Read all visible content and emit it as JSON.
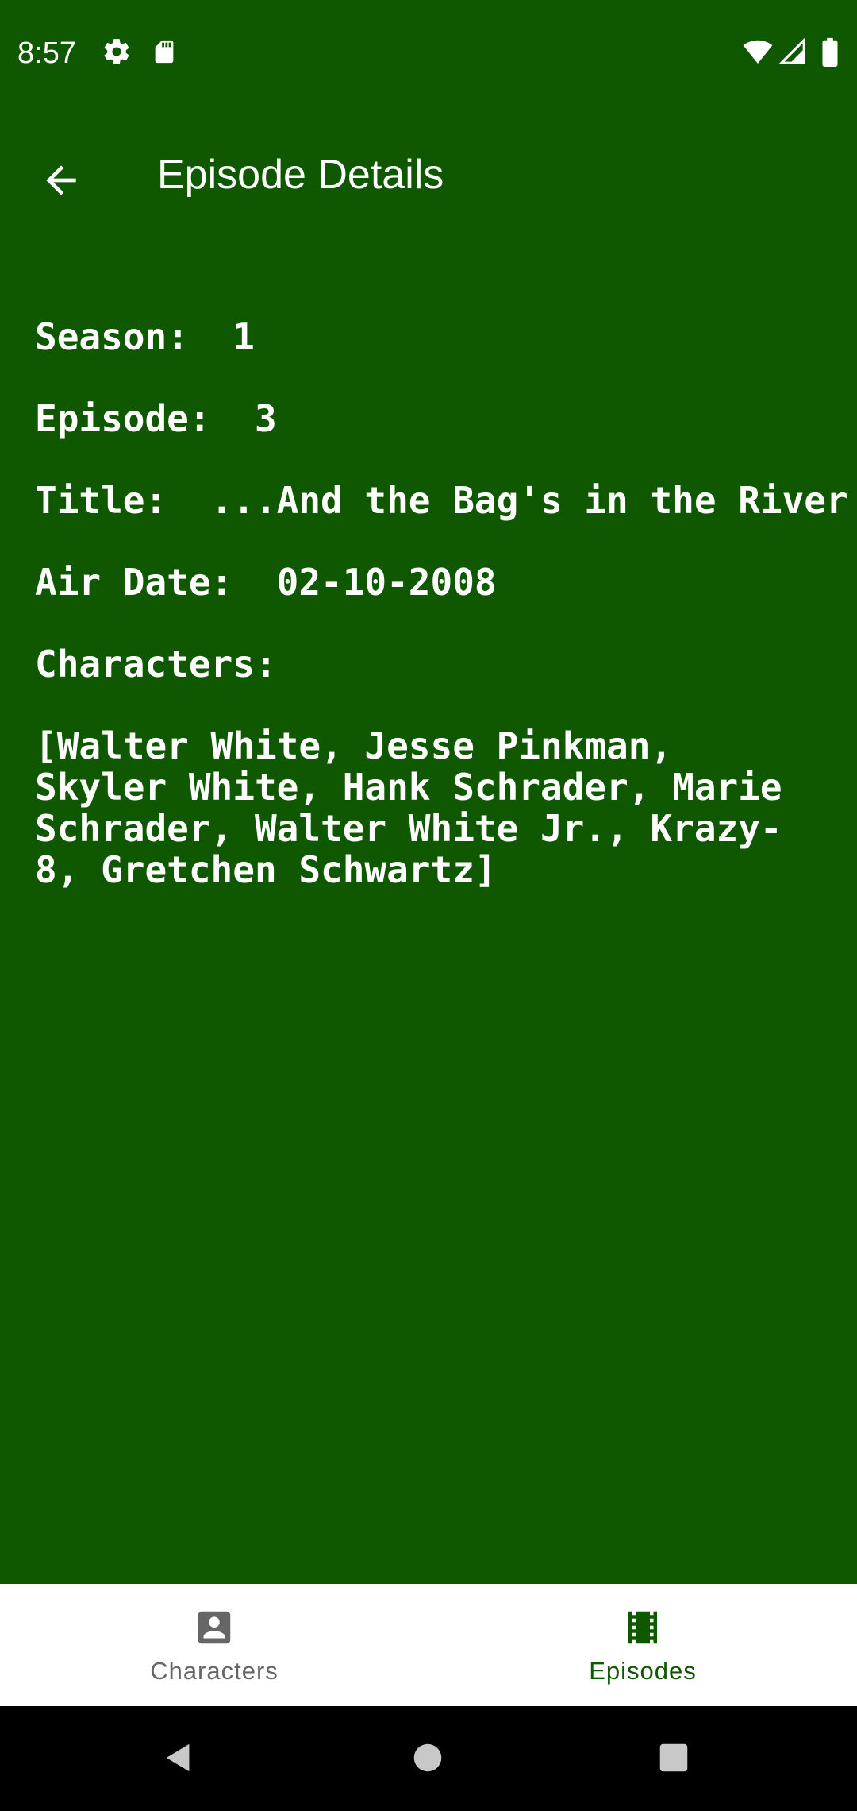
{
  "status_bar": {
    "time": "8:57",
    "icons": [
      "gear-icon",
      "sd-card-icon",
      "wifi-icon",
      "signal-icon",
      "battery-icon"
    ]
  },
  "app_bar": {
    "title": "Episode Details",
    "back_icon": "arrow-back-icon"
  },
  "details": {
    "season": "Season:  1",
    "episode": "Episode:  3",
    "title": "Title:  ...And the Bag's in the River",
    "air_date": "Air Date:  02-10-2008",
    "characters_label": "Characters:",
    "characters_list": "[Walter White, Jesse Pinkman, Skyler White, Hank Schrader, Marie Schrader, Walter White Jr., Krazy-8, Gretchen Schwartz]"
  },
  "bottom_nav": {
    "items": [
      {
        "label": "Characters",
        "icon": "person-icon",
        "active": false
      },
      {
        "label": "Episodes",
        "icon": "film-icon",
        "active": true
      }
    ]
  },
  "colors": {
    "primary": "#0f5800",
    "nav_inactive": "#666666",
    "white": "#ffffff"
  }
}
